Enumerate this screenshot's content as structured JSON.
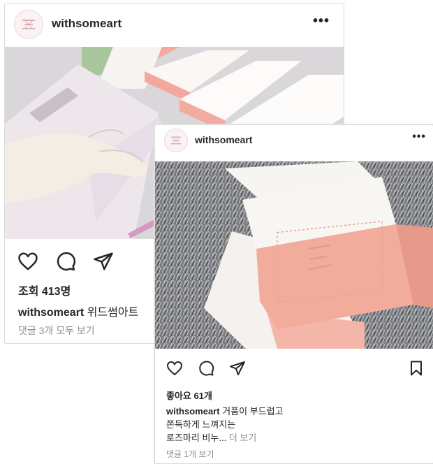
{
  "post1": {
    "username": "withsomeart",
    "more_icon": "•••",
    "views": "조회 413명",
    "caption_user": "withsomeart",
    "caption_text": "위드썸아트",
    "comments": "댓글 3개 모두 보기",
    "icons": [
      "heart-icon",
      "comment-icon",
      "share-icon"
    ]
  },
  "post2": {
    "username": "withsomeart",
    "more_icon": "•••",
    "likes": "좋아요 61개",
    "caption_user": "withsomeart",
    "caption_line1": "거품이 부드럽고",
    "caption_line2": "쫀득하게 느껴지는",
    "caption_line3": "로즈마리 비누...",
    "more_link": "더 보기",
    "comments": "댓글 1개 보기",
    "icons": [
      "heart-icon",
      "comment-icon",
      "share-icon",
      "bookmark-icon"
    ]
  },
  "colors": {
    "text": "#262626",
    "muted": "#8e8e8e",
    "soap_pink": "#f2b2a4",
    "soap_white": "#f7f5f2"
  }
}
